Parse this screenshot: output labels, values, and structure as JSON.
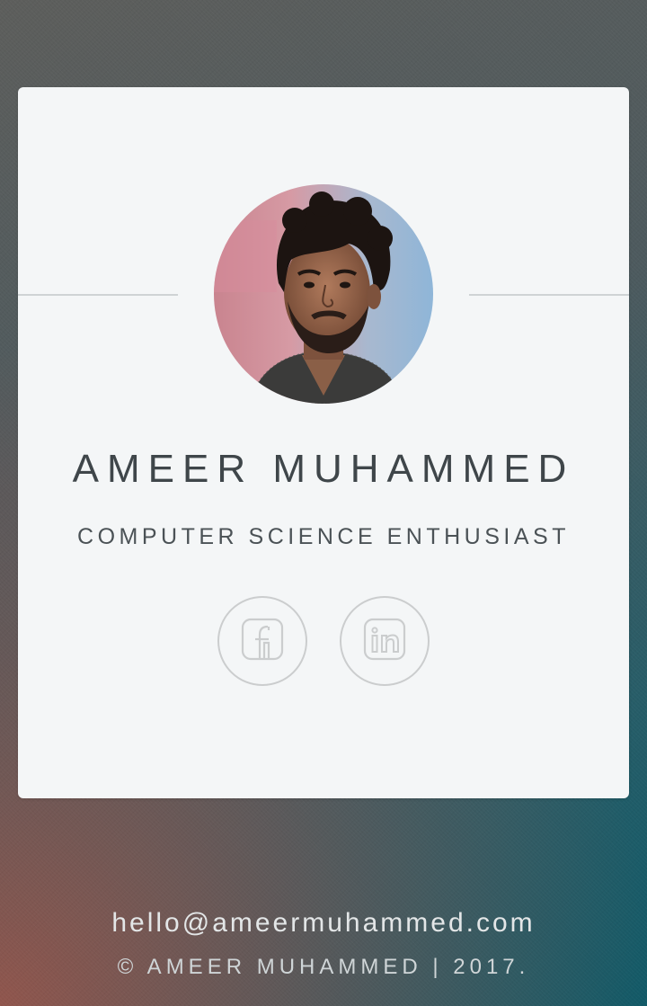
{
  "profile": {
    "name": "AMEER MUHAMMED",
    "tagline": "COMPUTER SCIENCE ENTHUSIAST"
  },
  "social": [
    {
      "icon": "facebook-icon"
    },
    {
      "icon": "linkedin-icon"
    }
  ],
  "footer": {
    "email": "hello@ameermuhammed.com",
    "copyright": "© AMEER MUHAMMED | 2017."
  },
  "colors": {
    "card_background": "#f4f6f7",
    "name_text": "#3f464a",
    "icon_stroke": "#cbcdce",
    "background_teal": "#0f5a68",
    "background_rose": "#96554b"
  }
}
